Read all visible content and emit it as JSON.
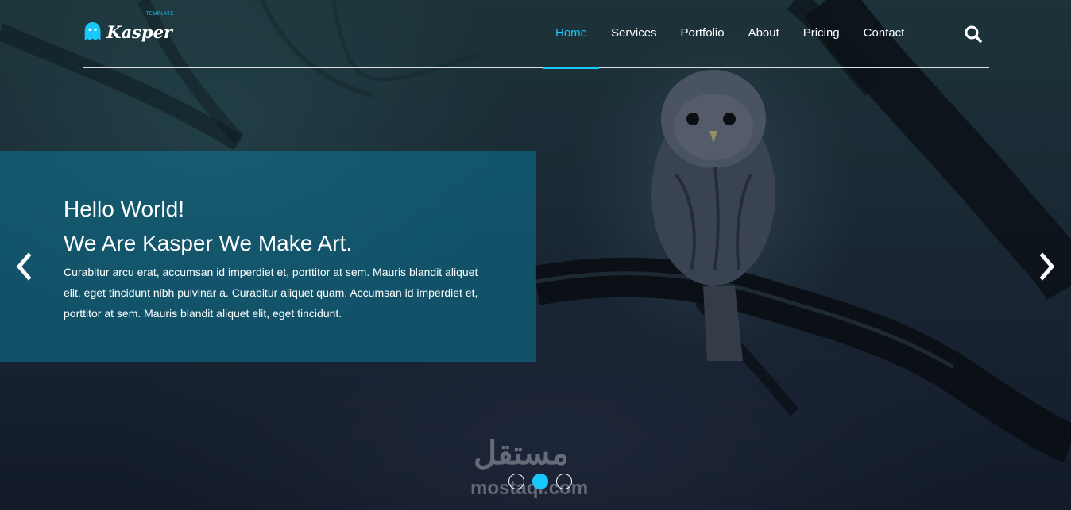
{
  "header": {
    "logo": {
      "name": "Kasper",
      "subtitle": "TEMPLATE",
      "icon": "ghost-icon"
    },
    "nav": [
      {
        "label": "Home",
        "active": true
      },
      {
        "label": "Services",
        "active": false
      },
      {
        "label": "Portfolio",
        "active": false
      },
      {
        "label": "About",
        "active": false
      },
      {
        "label": "Pricing",
        "active": false
      },
      {
        "label": "Contact",
        "active": false
      }
    ],
    "search_icon": "search-icon"
  },
  "slider": {
    "heading_line1": "Hello World!",
    "heading_line2": "We Are Kasper We Make Art.",
    "text": "Curabitur arcu erat, accumsan id imperdiet et, porttitor at sem. Mauris blandit aliquet elit, eget tincidunt nibh pulvinar a. Curabitur aliquet quam. Accumsan id imperdiet et, porttitor at sem. Mauris blandit aliquet elit, eget tincidunt.",
    "prev_icon": "chevron-left-icon",
    "next_icon": "chevron-right-icon",
    "bullets": [
      {
        "active": false
      },
      {
        "active": true
      },
      {
        "active": false
      }
    ]
  },
  "watermark": {
    "arabic": "مستقل",
    "latin": "mostaql.com"
  },
  "colors": {
    "accent": "#19c8fa",
    "intro_panel": "#0e6e8a"
  }
}
